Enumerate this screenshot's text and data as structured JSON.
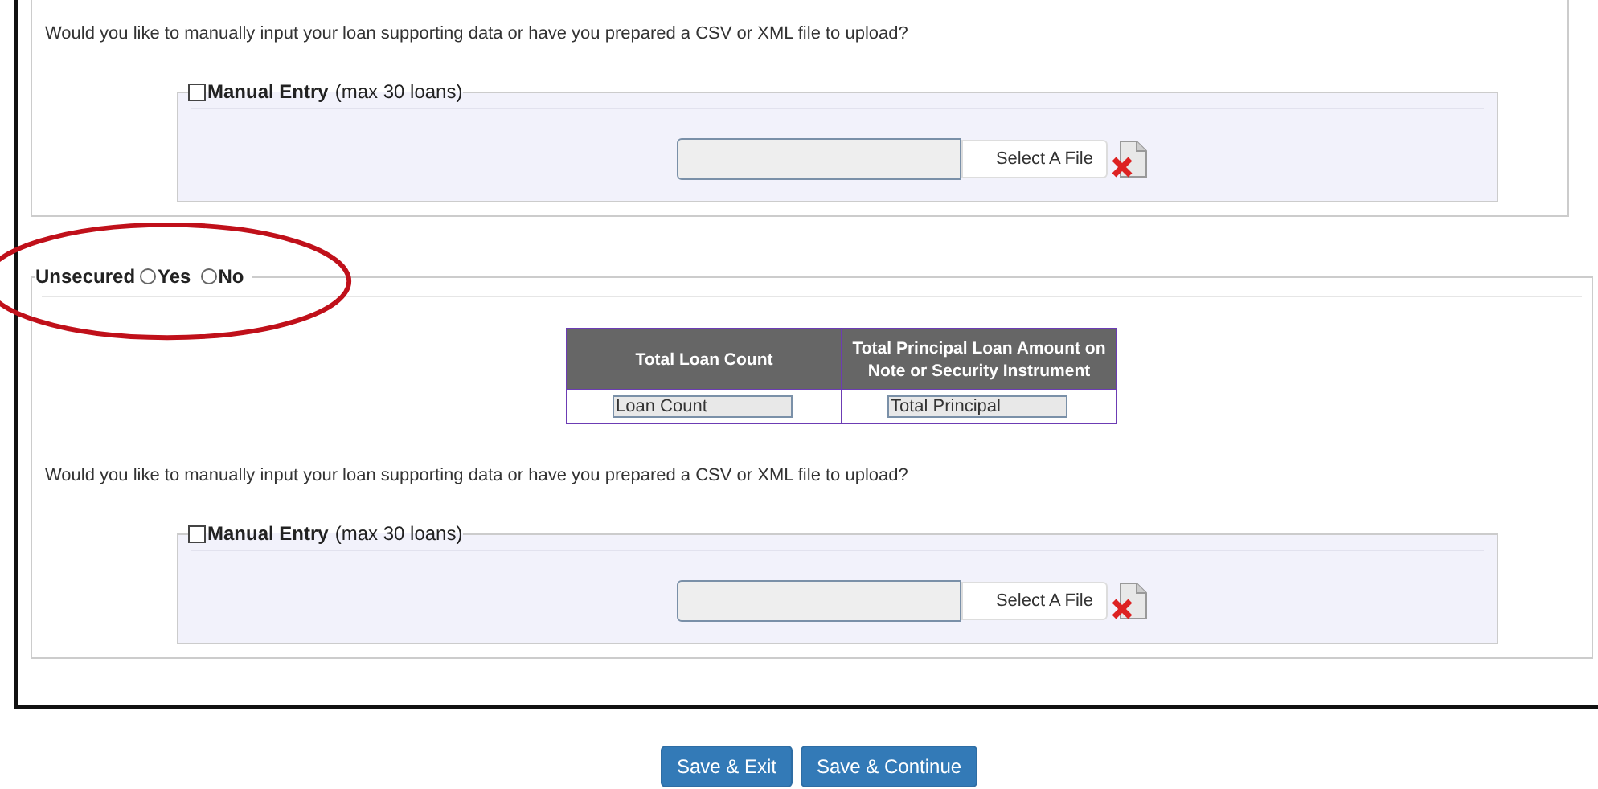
{
  "upload_section": {
    "question": "Would you like to manually input your loan supporting data or have you prepared a CSV or XML file to upload?",
    "manual_entry": {
      "label": "Manual Entry",
      "note": "(max 30 loans)",
      "checked": false
    },
    "file_button": "Select A File"
  },
  "unsecured_section": {
    "legend": "Unsecured",
    "options": [
      {
        "label": "Yes",
        "selected": false
      },
      {
        "label": "No",
        "selected": false
      }
    ],
    "table": {
      "columns": [
        "Total Loan Count",
        "Total Principal Loan Amount on Note or Security Instrument"
      ],
      "inputs": [
        "Loan Count",
        "Total Principal"
      ]
    },
    "upload": {
      "question": "Would you like to manually input your loan supporting data or have you prepared a CSV or XML file to upload?",
      "manual_entry": {
        "label": "Manual Entry",
        "note": "(max 30 loans)",
        "checked": false
      },
      "file_button": "Select A File"
    }
  },
  "buttons": [
    "Save & Exit",
    "Save & Continue"
  ]
}
